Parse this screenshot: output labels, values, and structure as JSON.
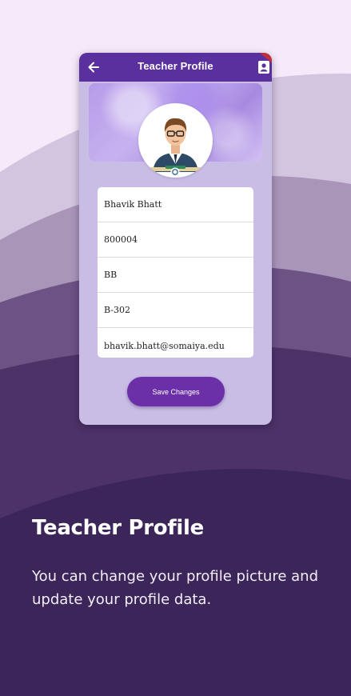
{
  "colors": {
    "appbar": "#5a2f9e",
    "save_button": "#6b2fa8",
    "background_dark": "#3c2559",
    "background_light": "#f6eafa"
  },
  "phone": {
    "appbar": {
      "title": "Teacher Profile",
      "back_icon": "arrow-left-icon",
      "action_icon": "profile-icon"
    },
    "avatar": {
      "camera_icon": "camera-icon"
    },
    "fields": [
      {
        "value": "Bhavik Bhatt"
      },
      {
        "value": "800004"
      },
      {
        "value": "BB"
      },
      {
        "value": "B-302"
      },
      {
        "value": "bhavik.bhatt@somaiya.edu"
      }
    ],
    "save_label": "Save Changes"
  },
  "onboarding": {
    "title": "Teacher Profile",
    "description": "You can change your profile picture and update your profile data."
  }
}
